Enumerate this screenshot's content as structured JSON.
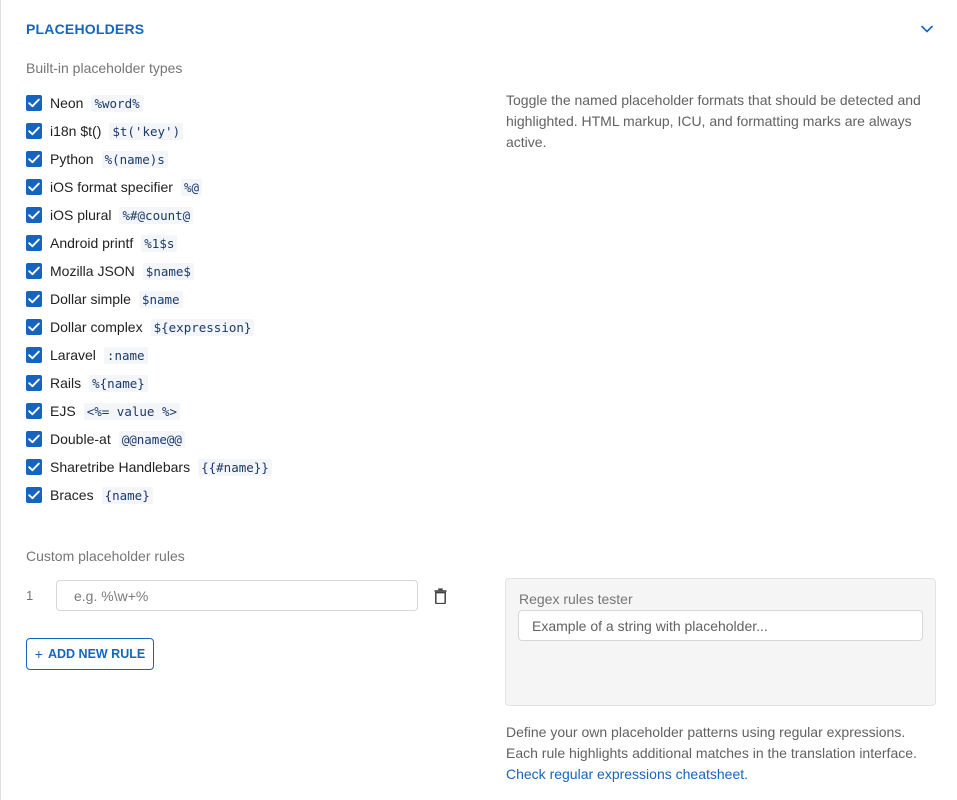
{
  "section": {
    "title": "PLACEHOLDERS",
    "collapse_icon": "chevron-up-icon"
  },
  "builtin": {
    "heading": "Built-in placeholder types",
    "description": "Toggle the named placeholder formats that should be detected and highlighted. HTML markup, ICU, and formatting marks are always active.",
    "types": [
      {
        "label": "Neon",
        "example": "%word%",
        "checked": true
      },
      {
        "label": "i18n $t()",
        "example": "$t('key')",
        "checked": true
      },
      {
        "label": "Python",
        "example": "%(name)s",
        "checked": true
      },
      {
        "label": "iOS format specifier",
        "example": "%@",
        "checked": true
      },
      {
        "label": "iOS plural",
        "example": "%#@count@",
        "checked": true
      },
      {
        "label": "Android printf",
        "example": "%1$s",
        "checked": true
      },
      {
        "label": "Mozilla JSON",
        "example": "$name$",
        "checked": true
      },
      {
        "label": "Dollar simple",
        "example": "$name",
        "checked": true
      },
      {
        "label": "Dollar complex",
        "example": "${expression}",
        "checked": true
      },
      {
        "label": "Laravel",
        "example": ":name",
        "checked": true
      },
      {
        "label": "Rails",
        "example": "%{name}",
        "checked": true
      },
      {
        "label": "EJS",
        "example": "<%= value %>",
        "checked": true
      },
      {
        "label": "Double-at",
        "example": "@@name@@",
        "checked": true
      },
      {
        "label": "Sharetribe Handlebars",
        "example": "{{#name}}",
        "checked": true
      },
      {
        "label": "Braces",
        "example": "{name}",
        "checked": true
      }
    ]
  },
  "custom": {
    "heading": "Custom placeholder rules",
    "rules": [
      {
        "index": "1",
        "value": "",
        "placeholder": "e.g. %\\w+%"
      }
    ],
    "add_rule_label": "ADD NEW RULE",
    "tester": {
      "label": "Regex rules tester",
      "value": "",
      "placeholder": "Example of a string with placeholder..."
    },
    "help_line_1": "Define your own placeholder patterns using regular expressions.",
    "help_line_2": "Each rule highlights additional matches in the translation interface.",
    "cheatsheet_link": "Check regular expressions cheatsheet."
  },
  "colors": {
    "accent": "#1565c0",
    "muted_text": "#757575",
    "tester_background": "#f5f5f5"
  }
}
